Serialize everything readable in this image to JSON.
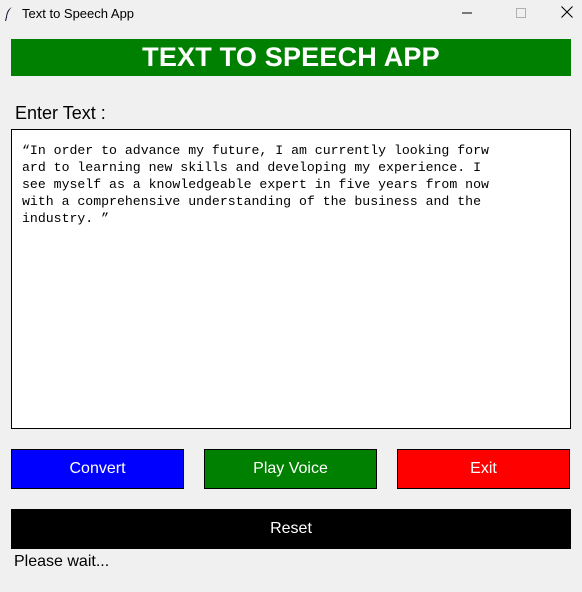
{
  "window": {
    "title": "Text to Speech App",
    "icon": "feather-icon"
  },
  "header": {
    "title": "TEXT TO SPEECH APP",
    "color": "#008000"
  },
  "input": {
    "label": "Enter Text :",
    "text": "“In order to advance my future, I am currently looking forw\nard to learning new skills and developing my experience. I\nsee myself as a knowledgeable expert in five years from now\nwith a comprehensive understanding of the business and the\nindustry. ”"
  },
  "buttons": {
    "convert": {
      "label": "Convert",
      "color": "#0000ff"
    },
    "play": {
      "label": "Play Voice",
      "color": "#008000"
    },
    "exit": {
      "label": "Exit",
      "color": "#ff0000"
    },
    "reset": {
      "label": "Reset",
      "color": "#000000"
    }
  },
  "status": {
    "text": "Please wait..."
  }
}
